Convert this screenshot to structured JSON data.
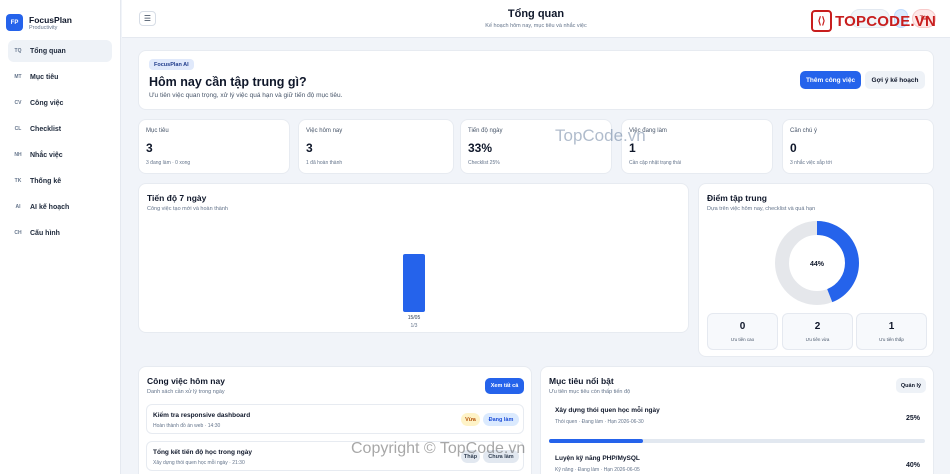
{
  "brand": {
    "logo": "FP",
    "name": "FocusPlan",
    "sub": "Productivity"
  },
  "sidebar": {
    "items": [
      {
        "code": "TQ",
        "label": "Tổng quan",
        "active": true
      },
      {
        "code": "MT",
        "label": "Mục tiêu"
      },
      {
        "code": "CV",
        "label": "Công việc"
      },
      {
        "code": "CL",
        "label": "Checklist"
      },
      {
        "code": "NH",
        "label": "Nhắc việc"
      },
      {
        "code": "TK",
        "label": "Thống kê"
      },
      {
        "code": "AI",
        "label": "AI kế hoạch"
      },
      {
        "code": "CH",
        "label": "Cấu hình"
      }
    ]
  },
  "header": {
    "menu_icon": "hamburger-icon",
    "title": "Tổng quan",
    "subtitle": "Kế hoạch hôm nay, mục tiêu và nhắc việc",
    "right_pill_1": "",
    "right_pill_2": "",
    "right_pill_3": "Tài"
  },
  "hero": {
    "chip": "FocusPlan AI",
    "title": "Hôm nay cần tập trung gì?",
    "subtitle": "Ưu tiên việc quan trọng, xử lý việc quá hạn và giữ tiến độ mục tiêu.",
    "primary_button": "Thêm công việc",
    "secondary_button": "Gợi ý kế hoạch"
  },
  "stats": [
    {
      "label": "Mục tiêu",
      "value": "3",
      "sub": "3 đang làm · 0 xong"
    },
    {
      "label": "Việc hôm nay",
      "value": "3",
      "sub": "1 đã hoàn thành"
    },
    {
      "label": "Tiến độ ngày",
      "value": "33%",
      "sub": "Checklist 25%"
    },
    {
      "label": "Việc đang làm",
      "value": "1",
      "sub": "Cần cập nhật trạng thái"
    },
    {
      "label": "Cần chú ý",
      "value": "0",
      "sub": "3 nhắc việc sắp tới"
    }
  ],
  "progress_chart": {
    "title": "Tiến độ 7 ngày",
    "subtitle": "Công việc tạo mới và hoàn thành"
  },
  "chart_data": {
    "type": "bar",
    "categories": [
      "15/05"
    ],
    "values": [
      1
    ],
    "value_labels": [
      "1/3"
    ],
    "title": "Tiến độ 7 ngày",
    "ylim": [
      0,
      1
    ]
  },
  "focus": {
    "title": "Điểm tập trung",
    "subtitle": "Dựa trên việc hôm nay, checklist và quá hạn",
    "percent": 44,
    "percent_label": "44%",
    "boxes": [
      {
        "value": "0",
        "label": "Ưu tiên cao"
      },
      {
        "value": "2",
        "label": "Ưu tiên vừa"
      },
      {
        "value": "1",
        "label": "Ưu tiên thấp"
      }
    ],
    "colors": {
      "fill": "#2563eb",
      "track": "#e5e7eb"
    }
  },
  "today_tasks": {
    "title": "Công việc hôm nay",
    "subtitle": "Danh sách cần xử lý trong ngày",
    "button": "Xem tất cả",
    "items": [
      {
        "title": "Kiểm tra responsive dashboard",
        "meta": "Hoàn thành đồ án web · 14:30",
        "priority": "Vừa",
        "status": "Đang làm"
      },
      {
        "title": "Tổng kết tiến độ học trong ngày",
        "meta": "Xây dựng thói quen học mỗi ngày · 21:30",
        "priority": "Thấp",
        "status": "Chưa làm"
      }
    ]
  },
  "goals": {
    "title": "Mục tiêu nổi bật",
    "subtitle": "Ưu tiên mục tiêu còn thấp tiến độ",
    "button": "Quản lý",
    "items": [
      {
        "title": "Xây dựng thói quen học mỗi ngày",
        "meta": "Thói quen · Đang làm · Hạn 2026-06-30",
        "percent_label": "25%",
        "progress": 0.25
      },
      {
        "title": "Luyện kỹ năng PHP/MySQL",
        "meta": "Kỹ năng · Đang làm · Hạn 2026-06-05",
        "percent_label": "40%",
        "progress": 0.4
      }
    ]
  },
  "watermarks": {
    "logo_text": "TOPCODE.VN",
    "center": "TopCode.vn",
    "bottom": "Copyright © TopCode.vn"
  }
}
